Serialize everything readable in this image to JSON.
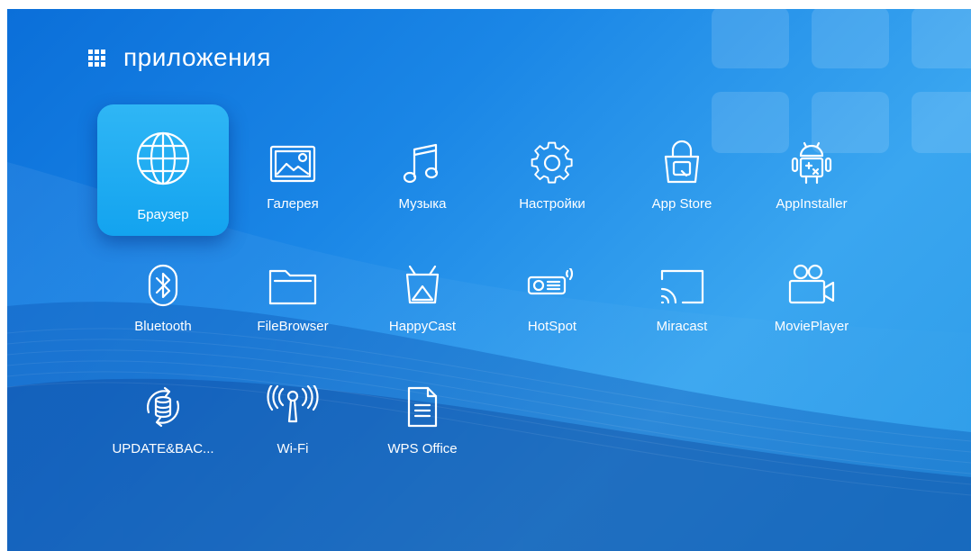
{
  "header": {
    "title": "приложения",
    "icon": "apps-grid-icon"
  },
  "apps": [
    {
      "label": "Браузер",
      "icon": "globe-icon",
      "focused": true
    },
    {
      "label": "Галерея",
      "icon": "image-icon"
    },
    {
      "label": "Музыка",
      "icon": "music-note-icon"
    },
    {
      "label": "Настройки",
      "icon": "gear-icon"
    },
    {
      "label": "App Store",
      "icon": "shopping-bag-icon"
    },
    {
      "label": "AppInstaller",
      "icon": "android-installer-icon"
    },
    {
      "label": "Bluetooth",
      "icon": "bluetooth-icon"
    },
    {
      "label": "FileBrowser",
      "icon": "folder-icon"
    },
    {
      "label": "HappyCast",
      "icon": "cast-tv-icon"
    },
    {
      "label": "HotSpot",
      "icon": "projector-icon"
    },
    {
      "label": "Miracast",
      "icon": "screen-cast-icon"
    },
    {
      "label": "MoviePlayer",
      "icon": "video-camera-icon"
    },
    {
      "label": "UPDATE&BAC...",
      "icon": "database-sync-icon"
    },
    {
      "label": "Wi-Fi",
      "icon": "wifi-antenna-icon"
    },
    {
      "label": "WPS Office",
      "icon": "document-icon"
    }
  ],
  "colors": {
    "bg_dark": "#0b6fd9",
    "bg_light": "#3aa6f0",
    "focus": "#1aaaf2",
    "text": "#ffffff"
  }
}
